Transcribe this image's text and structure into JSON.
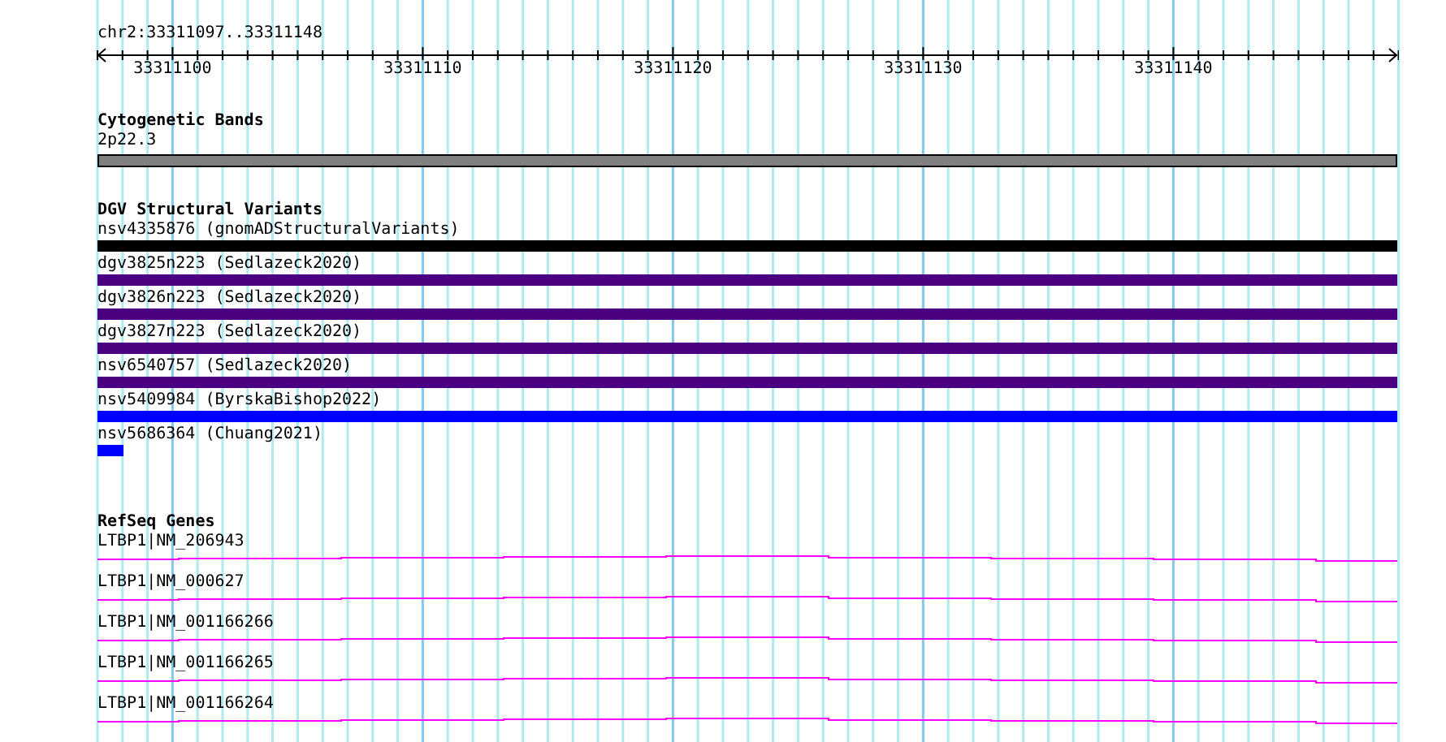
{
  "ruler": {
    "location": "chr2:33311097..33311148",
    "ticks": [
      "33311100",
      "33311110",
      "33311120",
      "33311130",
      "33311140"
    ]
  },
  "tracks": [
    {
      "kind": "bands",
      "title": "Cytogenetic Bands",
      "features": [
        {
          "label": "2p22.3",
          "color": "#808080",
          "kind": "full"
        }
      ]
    },
    {
      "kind": "variants",
      "title": "DGV Structural Variants",
      "features": [
        {
          "label": "nsv4335876 (gnomADStructuralVariants)",
          "color": "#000000",
          "kind": "full"
        },
        {
          "label": "dgv3825n223 (Sedlazeck2020)",
          "color": "#4b0082",
          "kind": "full"
        },
        {
          "label": "dgv3826n223 (Sedlazeck2020)",
          "color": "#4b0082",
          "kind": "full"
        },
        {
          "label": "dgv3827n223 (Sedlazeck2020)",
          "color": "#4b0082",
          "kind": "full"
        },
        {
          "label": "nsv6540757 (Sedlazeck2020)",
          "color": "#4b0082",
          "kind": "full"
        },
        {
          "label": "nsv5409984 (ByrskaBishop2022)",
          "color": "#0000ff",
          "kind": "full"
        },
        {
          "label": "nsv5686364 (Chuang2021)",
          "color": "#0000ff",
          "kind": "short"
        }
      ]
    },
    {
      "kind": "genes",
      "title": "RefSeq Genes",
      "features": [
        {
          "label": "LTBP1|NM_206943"
        },
        {
          "label": "LTBP1|NM_000627"
        },
        {
          "label": "LTBP1|NM_001166266"
        },
        {
          "label": "LTBP1|NM_001166265"
        },
        {
          "label": "LTBP1|NM_001166264"
        }
      ]
    }
  ]
}
